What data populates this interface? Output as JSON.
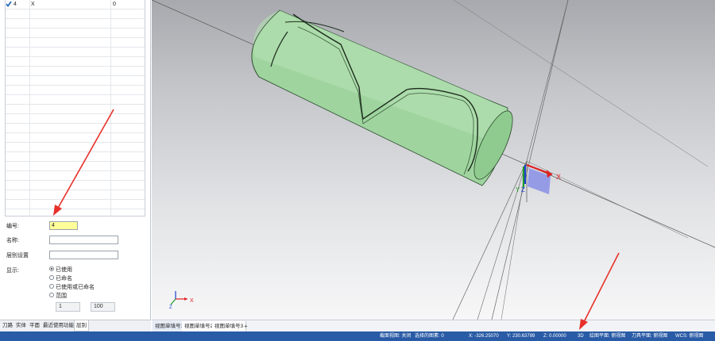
{
  "level_list": {
    "rows": [
      {
        "number": "4",
        "name": "X",
        "count": "0"
      }
    ]
  },
  "form": {
    "number_label": "编号:",
    "number_value": "4",
    "name_label": "名称:",
    "name_value": "",
    "group_label": "层别设置",
    "group_value": "",
    "display_label": "显示:",
    "options": [
      "已使用",
      "已命名",
      "已使用或已命名",
      "范围"
    ],
    "selected_option": "已使用",
    "range_from": "1",
    "range_to": "100"
  },
  "panel_tabs": [
    "刀路",
    "实体",
    "平面",
    "最近使用功能",
    "层别"
  ],
  "active_panel_tab": "层别",
  "view_tabs": [
    "视图单填号1",
    "视图单填号2",
    "视图单填号3"
  ],
  "active_view_tab": "视图单填号1",
  "view_add_label": "+",
  "axis": {
    "x_label": "X",
    "y_label": "Y",
    "z_label": "Z",
    "small_x": "X",
    "small_z": "Z"
  },
  "status_bar": {
    "section_view": "截面视图: 关闭",
    "selected": "选择的图素: 0",
    "x": "X: -326.25070",
    "y": "Y: 230.63789",
    "z": "Z: 0.00000",
    "mode": "3D",
    "plane": "绘图平面: 俯视图",
    "tool_plane": "刀具平面: 俯视图",
    "wcs": "WCS: 俯视图"
  },
  "colors": {
    "status_bar": "#295ba6",
    "part_green": "#9fd49f",
    "arrow_red": "#e8302a",
    "highlight_yellow": "#ffff99"
  }
}
